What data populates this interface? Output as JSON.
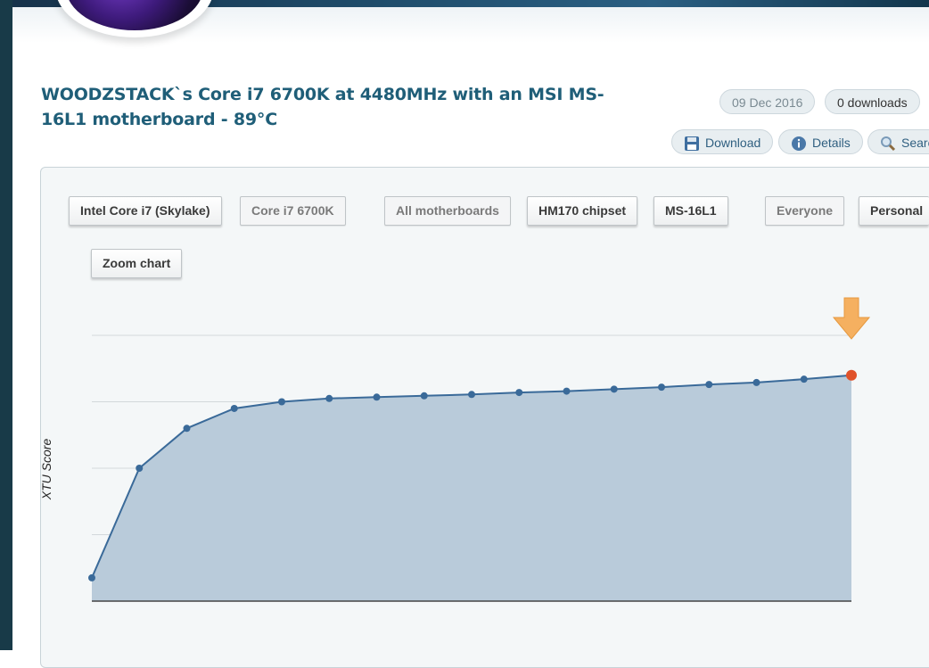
{
  "header": {
    "title": "WOODZSTACK`s Core i7 6700K at 4480MHz with an MSI MS-16L1 motherboard - 89°C",
    "date": "09 Dec 2016",
    "downloads": "0 downloads"
  },
  "actions": {
    "download": "Download",
    "details": "Details",
    "search": "Searc"
  },
  "filters": {
    "intel_core_i7_skylake": "Intel Core i7 (Skylake)",
    "core_i7_6700k": "Core i7 6700K",
    "all_motherboards": "All motherboards",
    "hm170_chipset": "HM170 chipset",
    "ms_16l1": "MS-16L1",
    "everyone": "Everyone",
    "personal": "Personal",
    "zoom_chart": "Zoom chart"
  },
  "icons": {
    "download": "floppy-disk-icon",
    "details": "info-icon",
    "search": "magnifier-icon",
    "marker": "arrow-down-icon"
  },
  "colors": {
    "title": "#1f5e78",
    "line": "#3a6a99",
    "area": "#b9cbda",
    "highlight_point": "#e0522a",
    "arrow": "#f5b060"
  },
  "chart_data": {
    "type": "area",
    "ylabel": "XTU Score",
    "xlabel": "",
    "title": "",
    "grid": true,
    "values": [
      0.35,
      2.0,
      2.6,
      2.9,
      3.0,
      3.05,
      3.07,
      3.09,
      3.11,
      3.14,
      3.16,
      3.19,
      3.22,
      3.26,
      3.29,
      3.34,
      3.4
    ],
    "ylim": [
      0,
      4
    ],
    "highlight_index": 16
  }
}
